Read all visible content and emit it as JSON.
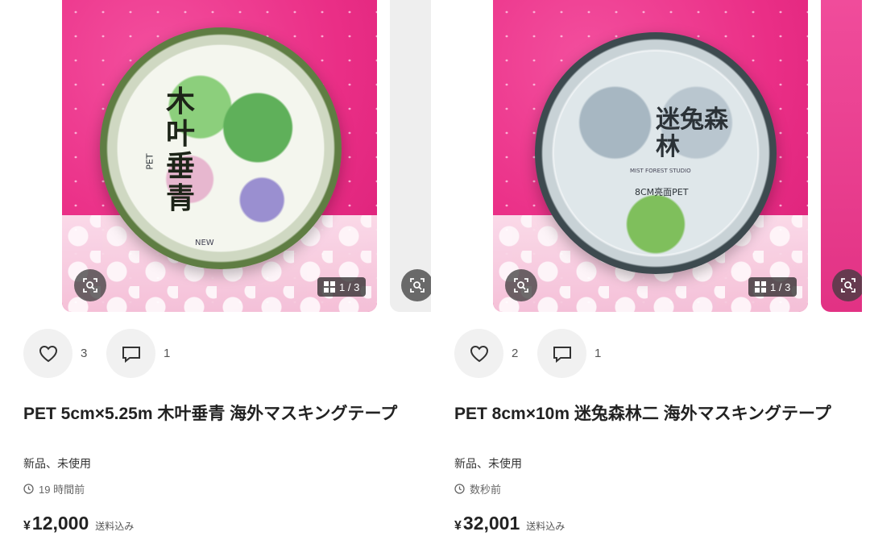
{
  "listings": [
    {
      "photo": {
        "tape_title": "木叶垂青",
        "tape_sub": "PET",
        "tape_tag": "NEW",
        "image_counter": "1 / 3"
      },
      "likes": "3",
      "comments": "1",
      "title": "PET 5cm×5.25m 木叶垂青 海外マスキングテープ",
      "condition": "新品、未使用",
      "time": "19 時間前",
      "price_symbol": "¥",
      "price": "12,000",
      "shipping": "送料込み"
    },
    {
      "photo": {
        "tape_title": "迷兔森林",
        "tape_sub": "8CM亮面PET",
        "tape_tag": "MIST FOREST STUDIO",
        "image_counter": "1 / 3"
      },
      "likes": "2",
      "comments": "1",
      "title": "PET 8cm×10m 迷兔森林二 海外マスキングテープ",
      "condition": "新品、未使用",
      "time": "数秒前",
      "price_symbol": "¥",
      "price": "32,001",
      "shipping": "送料込み"
    }
  ],
  "icons": {
    "lens": "visual-search-icon",
    "gallery": "gallery-grid-icon",
    "like": "heart-icon",
    "comment": "comment-icon",
    "time": "clock-icon"
  }
}
